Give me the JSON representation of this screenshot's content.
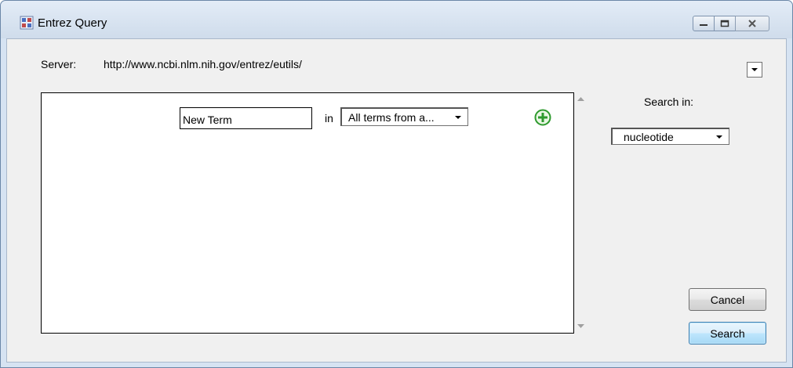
{
  "window": {
    "title": "Entrez Query",
    "app_icon": "entrez-app-icon",
    "controls": [
      "minimize-icon",
      "maximize-icon",
      "close-icon"
    ]
  },
  "server": {
    "label": "Server:",
    "url": "http://www.ncbi.nlm.nih.gov/entrez/eutils/"
  },
  "query": {
    "term_value": "New Term",
    "in_label": "in",
    "field_selected": "All terms from a...",
    "add_icon": "plus-circle-icon"
  },
  "search_in": {
    "label": "Search in:",
    "selected": "nucleotide"
  },
  "buttons": {
    "cancel": "Cancel",
    "search": "Search"
  },
  "colors": {
    "add_icon_green": "#2e9a2e",
    "default_button_border": "#3c7fb1"
  }
}
